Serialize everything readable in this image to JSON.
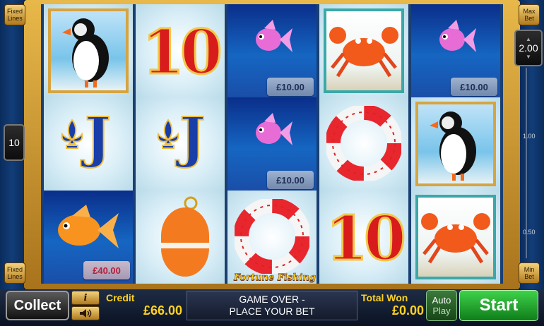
{
  "left_panel": {
    "fixed_lines_top": "Fixed Lines",
    "fixed_lines_bottom": "Fixed Lines",
    "lines_count": "10"
  },
  "right_panel": {
    "max_bet": "Max Bet",
    "min_bet": "Min Bet",
    "stake": "2.00",
    "scale_labels": [
      "1.00",
      "0.50"
    ]
  },
  "game_logo": "Fortune Fishing",
  "reels": [
    [
      "puffin",
      "J",
      "goldfish"
    ],
    [
      "10",
      "J",
      "buoy"
    ],
    [
      "pink-fish",
      "pink-fish",
      "life-ring"
    ],
    [
      "crab",
      "life-ring",
      "10"
    ],
    [
      "pink-fish",
      "puffin",
      "crab"
    ]
  ],
  "price_tags": {
    "reel1_goldfish": "£40.00",
    "reel3_top": "£10.00",
    "reel3_mid": "£10.00",
    "reel5_top": "£10.00"
  },
  "bottom_bar": {
    "collect_label": "Collect",
    "info_label": "i",
    "sound_icon": "speaker-icon",
    "credit_label": "Credit",
    "credit_value": "£66.00",
    "message_line1": "GAME OVER -",
    "message_line2": "PLACE YOUR BET",
    "total_won_label": "Total Won",
    "total_won_value": "£0.00",
    "auto_label": "Auto",
    "play_label": "Play",
    "start_label": "Start"
  },
  "colors": {
    "gold": "#ffd21f",
    "start_green": "#1fa52a",
    "frame_gold": "#d6a440"
  }
}
